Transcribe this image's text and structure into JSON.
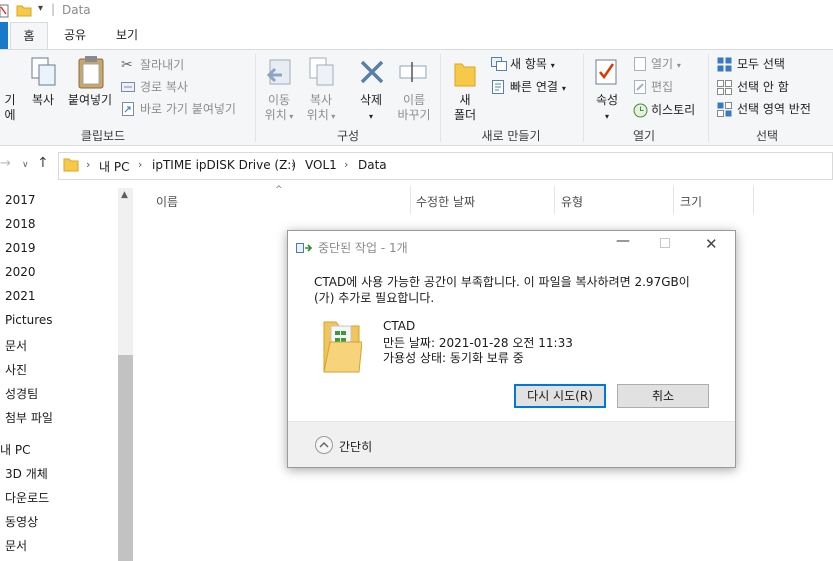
{
  "window": {
    "title": "Data"
  },
  "ribbon_tabs": [
    {
      "label": "홈"
    },
    {
      "label": "공유"
    },
    {
      "label": "보기"
    }
  ],
  "clipboard": {
    "pin_label": "기에",
    "copy_label": "복사",
    "paste_label": "붙여넣기",
    "cut_label": "잘라내기",
    "copy_path_label": "경로 복사",
    "paste_shortcut_label": "바로 가기 붙여넣기",
    "group_label": "클립보드"
  },
  "organize": {
    "move_to_l1": "이동",
    "move_to_l2": "위치",
    "copy_to_l1": "복사",
    "copy_to_l2": "위치",
    "delete_label": "삭제",
    "rename_l1": "이름",
    "rename_l2": "바꾸기",
    "group_label": "구성"
  },
  "new": {
    "new_folder_l1": "새",
    "new_folder_l2": "폴더",
    "new_item_label": "새 항목",
    "easy_access_label": "빠른 연결",
    "group_label": "새로 만들기"
  },
  "open": {
    "properties_label": "속성",
    "open_label": "열기",
    "edit_label": "편집",
    "history_label": "히스토리",
    "group_label": "열기"
  },
  "select": {
    "select_all_label": "모두 선택",
    "select_none_label": "선택 안 함",
    "invert_label": "선택 영역 반전",
    "group_label": "선택"
  },
  "address": {
    "crumbs": [
      "내 PC",
      "ipTIME ipDISK Drive (Z:)",
      "VOL1",
      "Data"
    ]
  },
  "nav": {
    "items": [
      "2017",
      "2018",
      "2019",
      "2020",
      "2021",
      "Pictures",
      "문서",
      "사진",
      "성경팀",
      "첨부 파일",
      "내 PC",
      "3D 개체",
      "다운로드",
      "동영상",
      "문서"
    ]
  },
  "columns": {
    "name": "이름",
    "modified": "수정한 날짜",
    "type": "유형",
    "size": "크기"
  },
  "dialog": {
    "title": "중단된 작업 - 1개",
    "message_line1": "CTAD에 사용 가능한 공간이 부족합니다. 이 파일을 복사하려면 2.97GB이",
    "message_line2": "(가) 추가로 필요합니다.",
    "file_name": "CTAD",
    "created": "만든 날짜: 2021-01-28 오전 11:33",
    "availability": "가용성 상태: 동기화 보류 중",
    "retry_label": "다시 시도(R)",
    "cancel_label": "취소",
    "less_details_label": "간단히"
  },
  "colors": {
    "accent": "#0078d7",
    "file_tab": "#1979ca",
    "folder": "#f7c948"
  }
}
